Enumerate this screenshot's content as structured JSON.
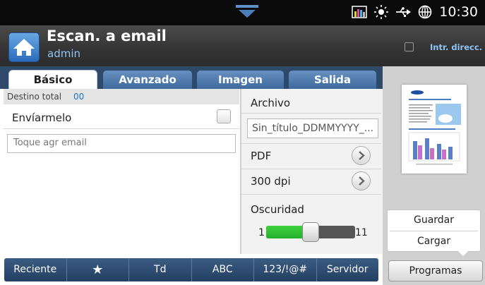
{
  "status_bar": {
    "time": "10:30",
    "icons": [
      "toner-icon",
      "sun-icon",
      "usb-icon",
      "globe-icon"
    ]
  },
  "header": {
    "title": "Escan. a email",
    "user": "admin",
    "address_book_label": "Intr. direcc."
  },
  "tabs": [
    {
      "label": "Básico",
      "active": true
    },
    {
      "label": "Avanzado",
      "active": false
    },
    {
      "label": "Imagen",
      "active": false
    },
    {
      "label": "Salida",
      "active": false
    }
  ],
  "left_pane": {
    "destination_label": "Destino total",
    "destination_count": "00",
    "send_to_me_label": "Envíarmelo",
    "send_to_me_checked": false,
    "email_placeholder": "Toque agr email"
  },
  "settings": {
    "file_label": "Archivo",
    "filename_value": "Sin_título_DDMMYYYY_...",
    "format": "PDF",
    "resolution": "300 dpi",
    "darkness_label": "Oscuridad",
    "darkness_min": "1",
    "darkness_max": "11",
    "darkness_value": 6
  },
  "popup_menu": {
    "items": [
      "Guardar",
      "Cargar"
    ]
  },
  "programs_label": "Programas",
  "bottom_bar": [
    "Reciente",
    "★",
    "Td",
    "ABC",
    "123/!@#",
    "Servidor"
  ],
  "colors": {
    "accent_blue": "#3e6a9e",
    "slider_green": "#22b02a",
    "link_blue": "#8fc3f2"
  }
}
